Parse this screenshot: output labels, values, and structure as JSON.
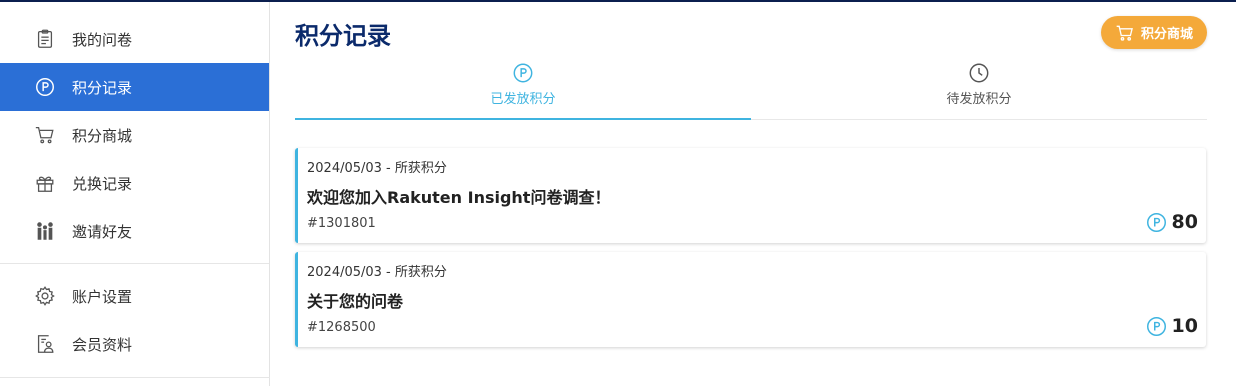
{
  "sidebar": {
    "items": [
      {
        "label": "我的问卷",
        "icon": "clipboard-icon",
        "active": false
      },
      {
        "label": "积分记录",
        "icon": "points-icon",
        "active": true
      },
      {
        "label": "积分商城",
        "icon": "cart-icon",
        "active": false
      },
      {
        "label": "兑换记录",
        "icon": "gift-icon",
        "active": false
      },
      {
        "label": "邀请好友",
        "icon": "people-icon",
        "active": false
      }
    ],
    "items2": [
      {
        "label": "账户设置",
        "icon": "gear-icon"
      },
      {
        "label": "会员资料",
        "icon": "profile-icon"
      }
    ]
  },
  "header": {
    "title": "积分记录",
    "shop_button": "积分商城"
  },
  "tabs": [
    {
      "label": "已发放积分",
      "icon": "points-icon",
      "active": true
    },
    {
      "label": "待发放积分",
      "icon": "clock-icon",
      "active": false
    }
  ],
  "records": [
    {
      "date_type": "2024/05/03 - 所获积分",
      "title": "欢迎您加入Rakuten Insight问卷调查！",
      "id": "#1301801",
      "points": "80"
    },
    {
      "date_type": "2024/05/03 - 所获积分",
      "title": "关于您的问卷",
      "id": "#1268500",
      "points": "10"
    }
  ],
  "colors": {
    "accent": "#3fb4e0",
    "active_nav": "#2b6fd6",
    "title": "#0b2a6b",
    "shop_button": "#f4a93a"
  }
}
